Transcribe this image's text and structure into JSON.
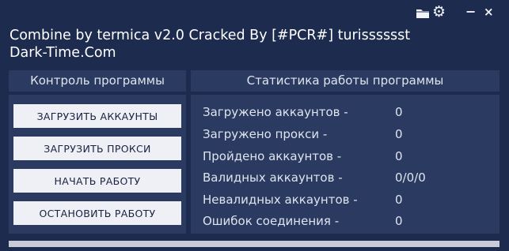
{
  "window": {
    "title": "Combine by termica v2.0 Cracked By [#PCR#] turisssssst",
    "subtitle": "Dark-Time.Com",
    "icons": [
      "folder-icon",
      "gear-icon",
      "minimize-icon",
      "close-icon"
    ],
    "minimize_glyph": "−",
    "close_glyph": "×"
  },
  "control_panel": {
    "header": "Контроль программы",
    "buttons": [
      {
        "label": "ЗАГРУЗИТЬ АККАУНТЫ"
      },
      {
        "label": "ЗАГРУЗИТЬ ПРОКСИ"
      },
      {
        "label": "НАЧАТЬ РАБОТУ"
      },
      {
        "label": "ОСТАНОВИТЬ РАБОТУ"
      }
    ]
  },
  "stats_panel": {
    "header": "Статистика работы программы",
    "rows": [
      {
        "label": "Загружено аккаунтов -",
        "value": "0"
      },
      {
        "label": "Загружено прокси -",
        "value": "0"
      },
      {
        "label": "Пройдено аккаунтов -",
        "value": "0"
      },
      {
        "label": "Валидных аккаунтов -",
        "value": "0/0/0"
      },
      {
        "label": "Невалидных аккаунтов -",
        "value": "0"
      },
      {
        "label": "Ошибок соединения -",
        "value": "0"
      }
    ]
  },
  "colors": {
    "window_bg": "#1d2b4e",
    "panel_bg": "#2a3a60",
    "button_bg": "#eef0f5",
    "text": "#dfe4ee"
  }
}
